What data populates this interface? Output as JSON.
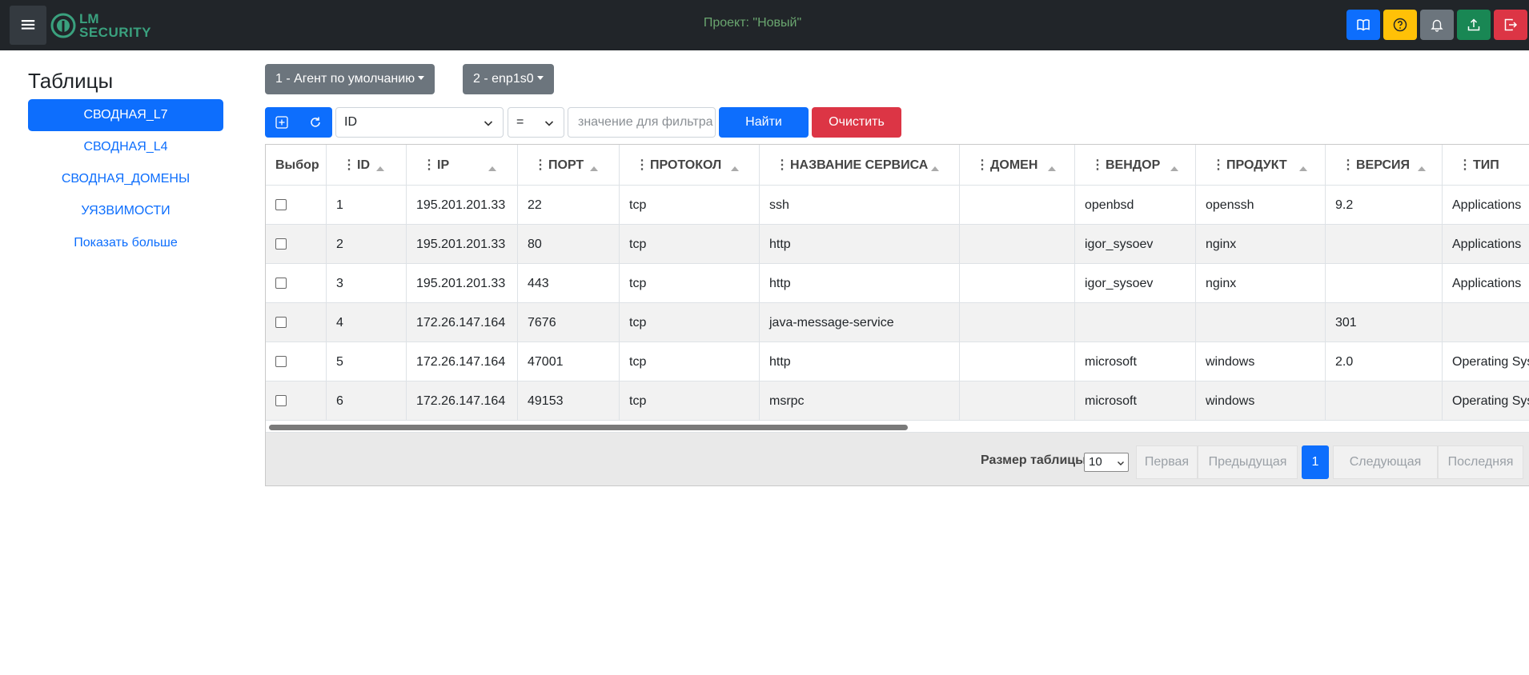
{
  "header": {
    "menu_icon": "≡",
    "logo_line1": "LM",
    "logo_line2": "SECURITY",
    "project_label": "Проект: \"Новый\"",
    "buttons": [
      {
        "name": "book-icon",
        "color": "#0d6efd"
      },
      {
        "name": "help-icon",
        "color": "#ffc107"
      },
      {
        "name": "bell-icon",
        "color": "#6c757d"
      },
      {
        "name": "upload-icon",
        "color": "#198754"
      },
      {
        "name": "logout-icon",
        "color": "#dc3545"
      }
    ]
  },
  "sidebar": {
    "title": "Таблицы",
    "items": [
      {
        "label": "СВОДНАЯ_L7",
        "active": true
      },
      {
        "label": "СВОДНАЯ_L4",
        "active": false
      },
      {
        "label": "СВОДНАЯ_ДОМЕНЫ",
        "active": false
      },
      {
        "label": "УЯЗВИМОСТИ",
        "active": false
      },
      {
        "label": "Показать больше",
        "active": false
      }
    ]
  },
  "selectors": {
    "agent": "1 - Агент по умолчанию",
    "interface": "2 - enp1s0"
  },
  "filter": {
    "field": "ID",
    "operator": "=",
    "value_placeholder": "значение для фильтра",
    "find_label": "Найти",
    "clear_label": "Очистить"
  },
  "table": {
    "columns": [
      "Выбор",
      "ID",
      "IP",
      "ПОРТ",
      "ПРОТОКОЛ",
      "НАЗВАНИЕ СЕРВИСА",
      "ДОМЕН",
      "ВЕНДОР",
      "ПРОДУКТ",
      "ВЕРСИЯ",
      "ТИП"
    ],
    "rows": [
      [
        "1",
        "195.201.201.33",
        "22",
        "tcp",
        "ssh",
        "",
        "openbsd",
        "openssh",
        "9.2",
        "Applications"
      ],
      [
        "2",
        "195.201.201.33",
        "80",
        "tcp",
        "http",
        "",
        "igor_sysoev",
        "nginx",
        "",
        "Applications"
      ],
      [
        "3",
        "195.201.201.33",
        "443",
        "tcp",
        "http",
        "",
        "igor_sysoev",
        "nginx",
        "",
        "Applications"
      ],
      [
        "4",
        "172.26.147.164",
        "7676",
        "tcp",
        "java-message-service",
        "",
        "",
        "",
        "301",
        ""
      ],
      [
        "5",
        "172.26.147.164",
        "47001",
        "tcp",
        "http",
        "",
        "microsoft",
        "windows",
        "2.0",
        "Operating Systems"
      ],
      [
        "6",
        "172.26.147.164",
        "49153",
        "tcp",
        "msrpc",
        "",
        "microsoft",
        "windows",
        "",
        "Operating Systems"
      ]
    ]
  },
  "pagination": {
    "size_label": "Размер таблицы",
    "size_value": "10",
    "first": "Первая",
    "prev": "Предыдущая",
    "current": "1",
    "next": "Следующая",
    "last": "Последняя"
  }
}
